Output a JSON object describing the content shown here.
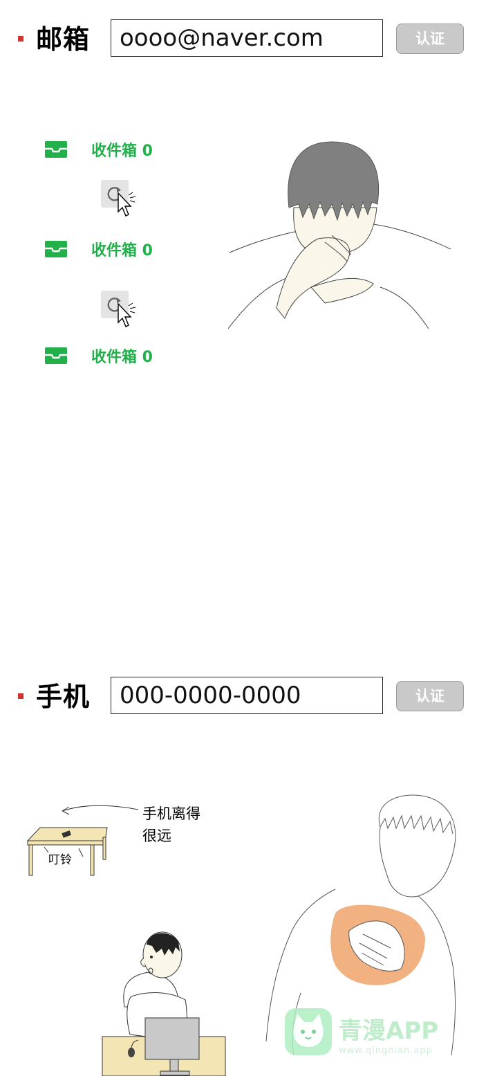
{
  "email": {
    "label": "邮箱",
    "value": "oooo@naver.com",
    "verify_label": "认证"
  },
  "inbox": {
    "items": [
      {
        "label": "收件箱 0"
      },
      {
        "label": "收件箱 0"
      },
      {
        "label": "收件箱 0"
      }
    ]
  },
  "phone": {
    "label": "手机",
    "value": "000-0000-0000",
    "verify_label": "认证"
  },
  "comic": {
    "caption_line1": "手机离得",
    "caption_line2": "很远",
    "sound_effect": "叮铃"
  },
  "watermark": {
    "brand": "青漫APP",
    "url": "www.qingnian.app"
  },
  "colors": {
    "bullet": "#d0342c",
    "inbox_green": "#22b04a",
    "blush": "#f0a36b"
  }
}
